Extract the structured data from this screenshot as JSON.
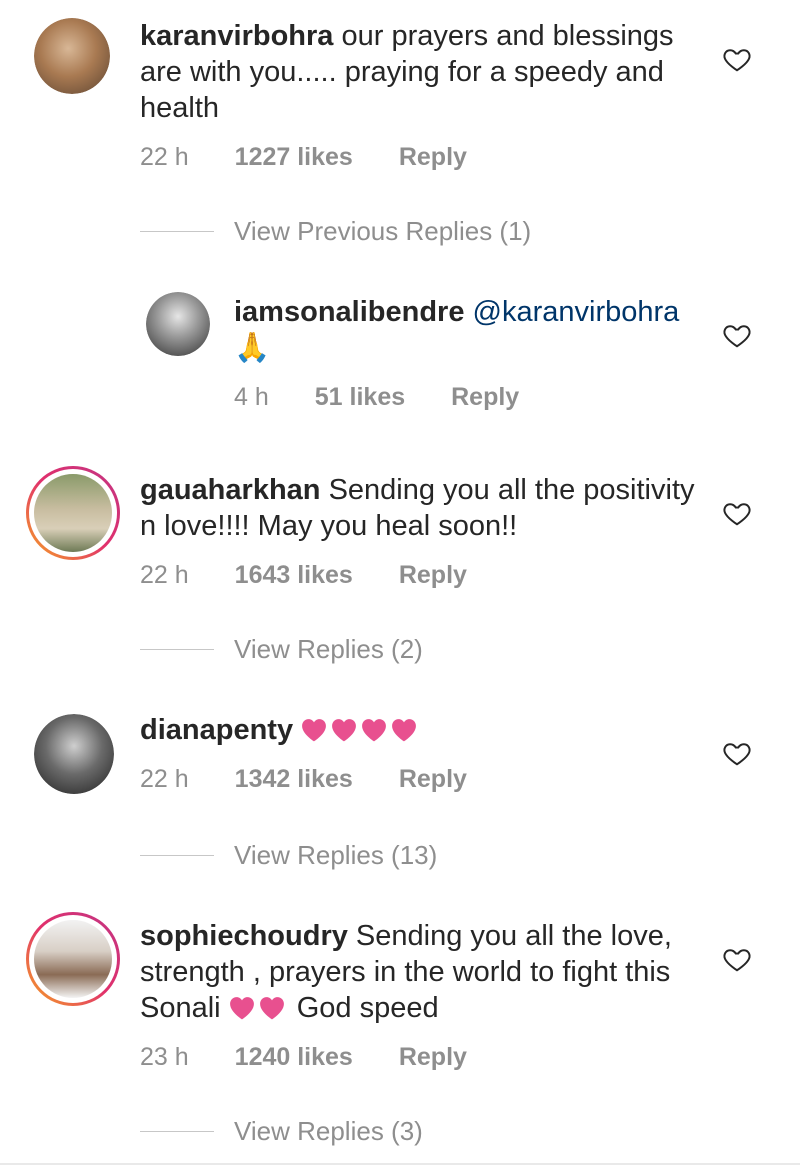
{
  "comments": [
    {
      "username": "karanvirbohra",
      "text": "our prayers and blessings are with you..... praying for a speedy and health",
      "time": "22 h",
      "likes": "1227 likes",
      "reply": "Reply",
      "view_replies": "View Previous Replies (1)",
      "story_ring": false
    },
    {
      "username": "iamsonalibendre",
      "mention": "@karanvirbohra",
      "emoji": "🙏",
      "time": "4 h",
      "likes": "51 likes",
      "reply": "Reply",
      "story_ring": false
    },
    {
      "username": "gauaharkhan",
      "text": "Sending you all the positivity n love!!!! May you heal soon!!",
      "time": "22 h",
      "likes": "1643 likes",
      "reply": "Reply",
      "view_replies": "View Replies (2)",
      "story_ring": true
    },
    {
      "username": "dianapenty",
      "hearts": 4,
      "time": "22 h",
      "likes": "1342 likes",
      "reply": "Reply",
      "view_replies": "View Replies (13)",
      "story_ring": false
    },
    {
      "username": "sophiechoudry",
      "text_a": "Sending you all the love, strength , prayers in the world  to fight this Sonali",
      "hearts": 2,
      "text_b": "God speed",
      "time": "23 h",
      "likes": "1240 likes",
      "reply": "Reply",
      "view_replies": "View Replies (3)",
      "story_ring": true
    }
  ],
  "colors": {
    "heart_emoji": "#e8508f",
    "meta_text": "#8e8e8e",
    "mention": "#003569",
    "story_ring": [
      "#f6a623",
      "#e1306c",
      "#c13584"
    ]
  }
}
